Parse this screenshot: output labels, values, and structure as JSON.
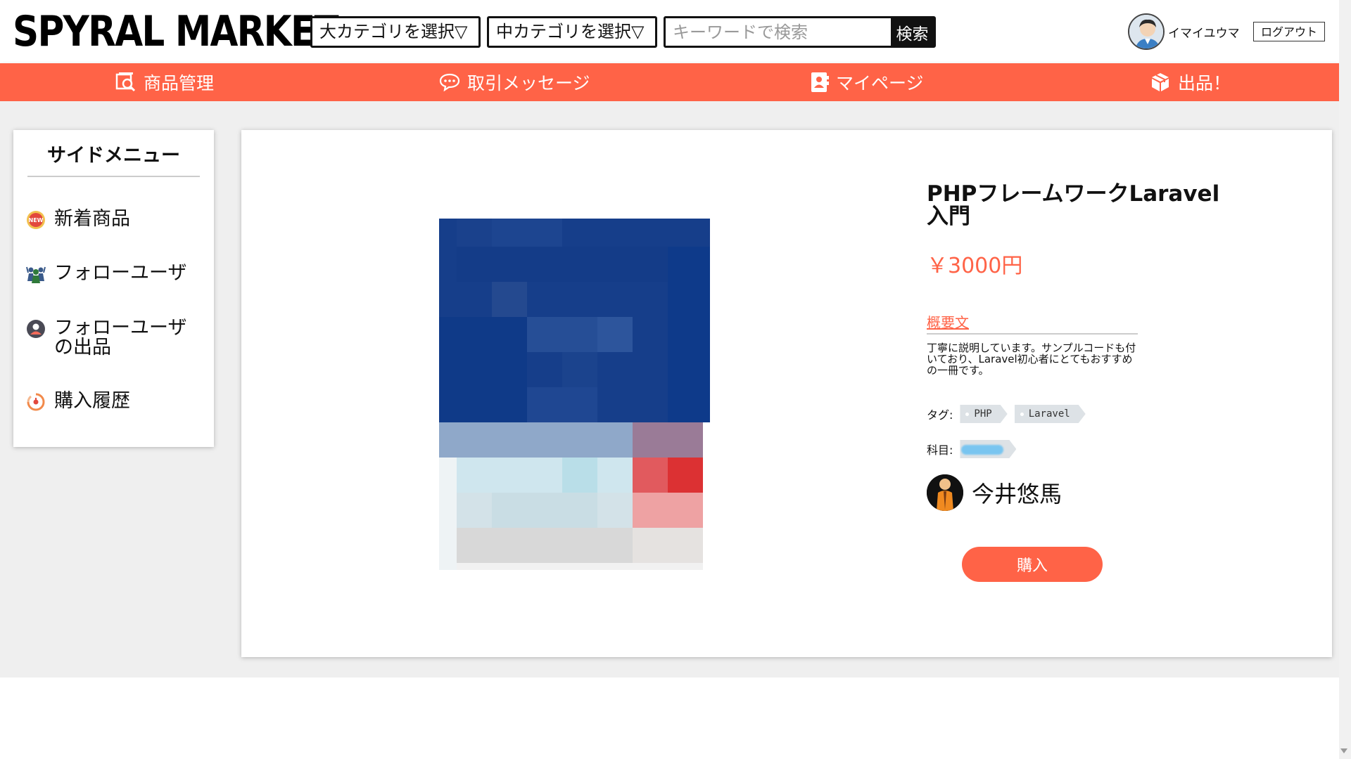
{
  "header": {
    "logo": "SPYRAL MARKET",
    "category_large": "大カテゴリを選択▽",
    "category_mid": "中カテゴリを選択▽",
    "search_placeholder": "キーワードで検索",
    "search_button": "検索",
    "username": "イマイユウマ",
    "logout": "ログアウト"
  },
  "nav": {
    "items": [
      {
        "label": "商品管理",
        "icon": "product-search-icon"
      },
      {
        "label": "取引メッセージ",
        "icon": "chat-bubble-icon"
      },
      {
        "label": "マイページ",
        "icon": "profile-card-icon"
      },
      {
        "label": "出品！",
        "icon": "box-icon"
      }
    ]
  },
  "sidebar": {
    "title": "サイドメニュー",
    "items": [
      {
        "label": "新着商品",
        "icon": "new-badge-icon"
      },
      {
        "label": "フォローユーザ",
        "icon": "group-users-icon"
      },
      {
        "label": "フォローユーザの出品",
        "icon": "user-circle-icon"
      },
      {
        "label": "購入履歴",
        "icon": "history-icon"
      }
    ]
  },
  "product": {
    "title": "PHPフレームワークLaravel入門",
    "price": "￥3000円",
    "description_heading": "概要文",
    "description": "丁寧に説明しています。サンプルコードも付いており、Laravel初心者にとてもおすすめの一冊です。",
    "tags_label": "タグ:",
    "tags": [
      "PHP",
      "Laravel"
    ],
    "subject_label": "科目:",
    "seller_name": "今井悠馬",
    "buy_button": "購入"
  },
  "colors": {
    "accent": "#ff6347",
    "background": "#efefef"
  }
}
